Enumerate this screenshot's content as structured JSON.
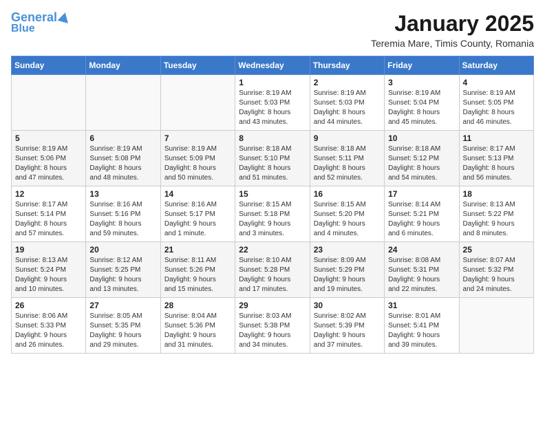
{
  "header": {
    "logo_line1": "General",
    "logo_line2": "Blue",
    "title": "January 2025",
    "subtitle": "Teremia Mare, Timis County, Romania"
  },
  "calendar": {
    "days_of_week": [
      "Sunday",
      "Monday",
      "Tuesday",
      "Wednesday",
      "Thursday",
      "Friday",
      "Saturday"
    ],
    "weeks": [
      [
        {
          "day": "",
          "info": ""
        },
        {
          "day": "",
          "info": ""
        },
        {
          "day": "",
          "info": ""
        },
        {
          "day": "1",
          "info": "Sunrise: 8:19 AM\nSunset: 5:03 PM\nDaylight: 8 hours\nand 43 minutes."
        },
        {
          "day": "2",
          "info": "Sunrise: 8:19 AM\nSunset: 5:03 PM\nDaylight: 8 hours\nand 44 minutes."
        },
        {
          "day": "3",
          "info": "Sunrise: 8:19 AM\nSunset: 5:04 PM\nDaylight: 8 hours\nand 45 minutes."
        },
        {
          "day": "4",
          "info": "Sunrise: 8:19 AM\nSunset: 5:05 PM\nDaylight: 8 hours\nand 46 minutes."
        }
      ],
      [
        {
          "day": "5",
          "info": "Sunrise: 8:19 AM\nSunset: 5:06 PM\nDaylight: 8 hours\nand 47 minutes."
        },
        {
          "day": "6",
          "info": "Sunrise: 8:19 AM\nSunset: 5:08 PM\nDaylight: 8 hours\nand 48 minutes."
        },
        {
          "day": "7",
          "info": "Sunrise: 8:19 AM\nSunset: 5:09 PM\nDaylight: 8 hours\nand 50 minutes."
        },
        {
          "day": "8",
          "info": "Sunrise: 8:18 AM\nSunset: 5:10 PM\nDaylight: 8 hours\nand 51 minutes."
        },
        {
          "day": "9",
          "info": "Sunrise: 8:18 AM\nSunset: 5:11 PM\nDaylight: 8 hours\nand 52 minutes."
        },
        {
          "day": "10",
          "info": "Sunrise: 8:18 AM\nSunset: 5:12 PM\nDaylight: 8 hours\nand 54 minutes."
        },
        {
          "day": "11",
          "info": "Sunrise: 8:17 AM\nSunset: 5:13 PM\nDaylight: 8 hours\nand 56 minutes."
        }
      ],
      [
        {
          "day": "12",
          "info": "Sunrise: 8:17 AM\nSunset: 5:14 PM\nDaylight: 8 hours\nand 57 minutes."
        },
        {
          "day": "13",
          "info": "Sunrise: 8:16 AM\nSunset: 5:16 PM\nDaylight: 8 hours\nand 59 minutes."
        },
        {
          "day": "14",
          "info": "Sunrise: 8:16 AM\nSunset: 5:17 PM\nDaylight: 9 hours\nand 1 minute."
        },
        {
          "day": "15",
          "info": "Sunrise: 8:15 AM\nSunset: 5:18 PM\nDaylight: 9 hours\nand 3 minutes."
        },
        {
          "day": "16",
          "info": "Sunrise: 8:15 AM\nSunset: 5:20 PM\nDaylight: 9 hours\nand 4 minutes."
        },
        {
          "day": "17",
          "info": "Sunrise: 8:14 AM\nSunset: 5:21 PM\nDaylight: 9 hours\nand 6 minutes."
        },
        {
          "day": "18",
          "info": "Sunrise: 8:13 AM\nSunset: 5:22 PM\nDaylight: 9 hours\nand 8 minutes."
        }
      ],
      [
        {
          "day": "19",
          "info": "Sunrise: 8:13 AM\nSunset: 5:24 PM\nDaylight: 9 hours\nand 10 minutes."
        },
        {
          "day": "20",
          "info": "Sunrise: 8:12 AM\nSunset: 5:25 PM\nDaylight: 9 hours\nand 13 minutes."
        },
        {
          "day": "21",
          "info": "Sunrise: 8:11 AM\nSunset: 5:26 PM\nDaylight: 9 hours\nand 15 minutes."
        },
        {
          "day": "22",
          "info": "Sunrise: 8:10 AM\nSunset: 5:28 PM\nDaylight: 9 hours\nand 17 minutes."
        },
        {
          "day": "23",
          "info": "Sunrise: 8:09 AM\nSunset: 5:29 PM\nDaylight: 9 hours\nand 19 minutes."
        },
        {
          "day": "24",
          "info": "Sunrise: 8:08 AM\nSunset: 5:31 PM\nDaylight: 9 hours\nand 22 minutes."
        },
        {
          "day": "25",
          "info": "Sunrise: 8:07 AM\nSunset: 5:32 PM\nDaylight: 9 hours\nand 24 minutes."
        }
      ],
      [
        {
          "day": "26",
          "info": "Sunrise: 8:06 AM\nSunset: 5:33 PM\nDaylight: 9 hours\nand 26 minutes."
        },
        {
          "day": "27",
          "info": "Sunrise: 8:05 AM\nSunset: 5:35 PM\nDaylight: 9 hours\nand 29 minutes."
        },
        {
          "day": "28",
          "info": "Sunrise: 8:04 AM\nSunset: 5:36 PM\nDaylight: 9 hours\nand 31 minutes."
        },
        {
          "day": "29",
          "info": "Sunrise: 8:03 AM\nSunset: 5:38 PM\nDaylight: 9 hours\nand 34 minutes."
        },
        {
          "day": "30",
          "info": "Sunrise: 8:02 AM\nSunset: 5:39 PM\nDaylight: 9 hours\nand 37 minutes."
        },
        {
          "day": "31",
          "info": "Sunrise: 8:01 AM\nSunset: 5:41 PM\nDaylight: 9 hours\nand 39 minutes."
        },
        {
          "day": "",
          "info": ""
        }
      ]
    ]
  }
}
